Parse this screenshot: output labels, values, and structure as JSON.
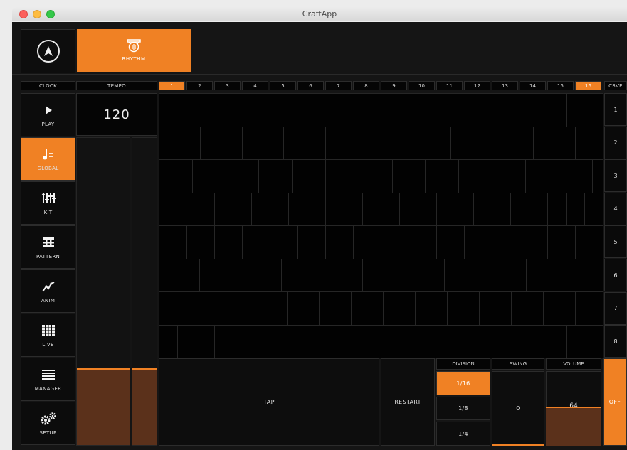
{
  "window": {
    "title": "CraftApp"
  },
  "header": {
    "tab_label": "RHYTHM"
  },
  "top_strip": {
    "clock_label": "CLOCK",
    "tempo_label": "TEMPO",
    "curve_label": "CRVE",
    "steps": [
      "1",
      "2",
      "3",
      "4",
      "5",
      "6",
      "7",
      "8",
      "9",
      "10",
      "11",
      "12",
      "13",
      "14",
      "15",
      "16"
    ],
    "active_step": "16",
    "highlight_step": "1"
  },
  "sidebar": {
    "items": [
      {
        "label": "PLAY",
        "icon": "play-icon"
      },
      {
        "label": "GLOBAL",
        "icon": "note-icon",
        "active": true
      },
      {
        "label": "KIT",
        "icon": "sliders-icon"
      },
      {
        "label": "PATTERN",
        "icon": "pattern-icon"
      },
      {
        "label": "ANIM",
        "icon": "curve-icon"
      },
      {
        "label": "LIVE",
        "icon": "grid-icon"
      },
      {
        "label": "MANAGER",
        "icon": "menu-icon"
      },
      {
        "label": "SETUP",
        "icon": "gears-icon"
      }
    ]
  },
  "tempo": {
    "value": "120",
    "fader_level": 0.25
  },
  "curve_rows": [
    "1",
    "2",
    "3",
    "4",
    "5",
    "6",
    "7",
    "8"
  ],
  "bottom": {
    "tap_label": "TAP",
    "restart_label": "RESTART",
    "division_label": "DIVISION",
    "division_options": [
      "1/16",
      "1/8",
      "1/4"
    ],
    "division_selected": "1/16",
    "swing_label": "SWING",
    "swing_value": "0",
    "volume_label": "VOLUME",
    "volume_value": "64",
    "off_label": "OFF"
  },
  "colors": {
    "accent": "#f08124",
    "fill": "#5b311b",
    "background": "#151515"
  }
}
